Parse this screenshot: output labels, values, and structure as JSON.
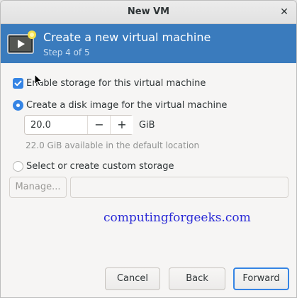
{
  "window": {
    "title": "New VM"
  },
  "header": {
    "title": "Create a new virtual machine",
    "step": "Step 4 of 5"
  },
  "options": {
    "enable_storage": {
      "label": "Enable storage for this virtual machine",
      "checked": true
    },
    "create_disk": {
      "label": "Create a disk image for the virtual machine",
      "selected": true
    },
    "custom_storage": {
      "label": "Select or create custom storage",
      "selected": false
    }
  },
  "disk": {
    "size": "20.0",
    "unit": "GiB",
    "decrement": "−",
    "increment": "+",
    "available_hint": "22.0 GiB available in the default location"
  },
  "custom": {
    "manage_label": "Manage...",
    "path_value": ""
  },
  "watermark": "computingforgeeks.com",
  "buttons": {
    "cancel": "Cancel",
    "back": "Back",
    "forward": "Forward"
  },
  "colors": {
    "header_bg": "#3a7bbd",
    "accent": "#3584e4",
    "watermark": "#2a2ad6"
  }
}
